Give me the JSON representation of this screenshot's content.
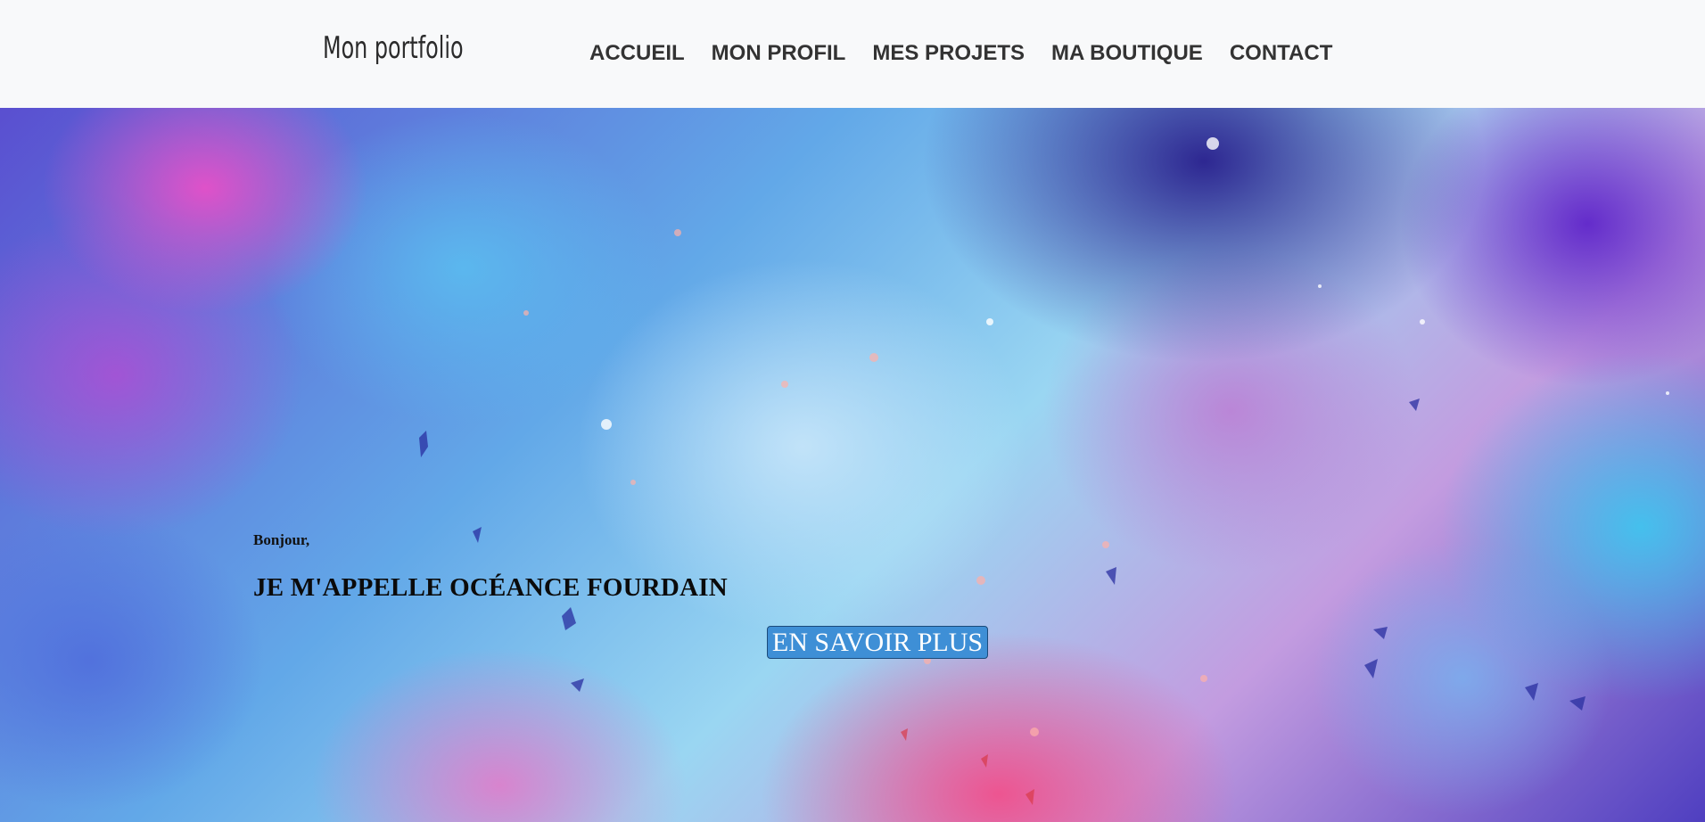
{
  "navbar": {
    "brand": "Mon portfolio",
    "items": [
      {
        "label": "ACCUEIL"
      },
      {
        "label": "MON PROFIL"
      },
      {
        "label": "MES PROJETS"
      },
      {
        "label": "MA BOUTIQUE"
      },
      {
        "label": "CONTACT"
      }
    ]
  },
  "hero": {
    "greeting": "Bonjour,",
    "headline": "JE M'APPELLE OCÉANCE FOURDAIN",
    "cta_label": "EN SAVOIR PLUS",
    "cta_color": "#3e8fd6"
  }
}
